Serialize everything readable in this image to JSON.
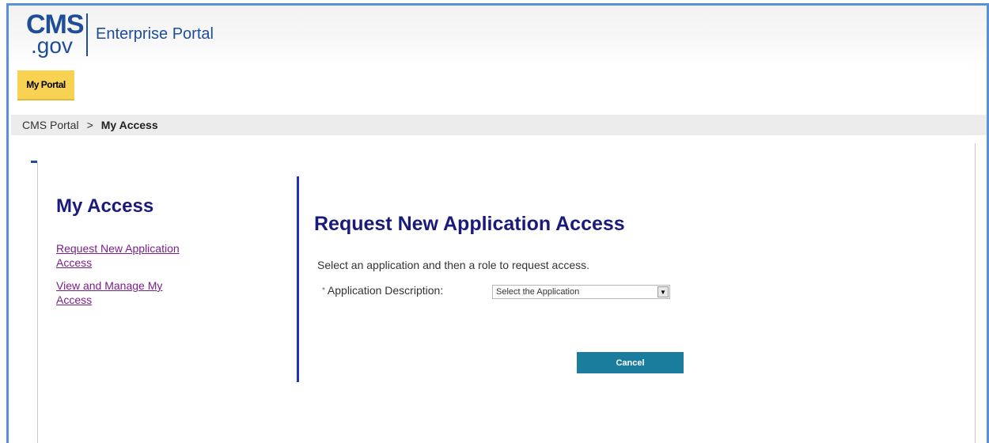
{
  "header": {
    "logo_cms": "CMS",
    "logo_gov": ".gov",
    "portal_name": "Enterprise Portal"
  },
  "nav": {
    "tab_label": "My Portal"
  },
  "breadcrumb": {
    "root": "CMS Portal",
    "separator": ">",
    "current": "My Access"
  },
  "sidebar": {
    "title": "My Access",
    "links": [
      {
        "label": "Request New Application Access"
      },
      {
        "label": "View and Manage My Access"
      }
    ]
  },
  "main": {
    "title": "Request New Application Access",
    "instruction": "Select an application and then a role to request access.",
    "field": {
      "required_mark": "*",
      "label": "Application Description:",
      "select_value": "Select the Application"
    },
    "cancel_label": "Cancel"
  },
  "colors": {
    "brand_blue": "#1f4e96",
    "title_navy": "#1a1a7a",
    "tab_yellow": "#f7d253",
    "link_purple": "#7a1f8a",
    "divider_blue": "#2233bb",
    "button_teal": "#1a7d9e"
  },
  "icons": {
    "select_arrow": "chevron-down-icon"
  }
}
